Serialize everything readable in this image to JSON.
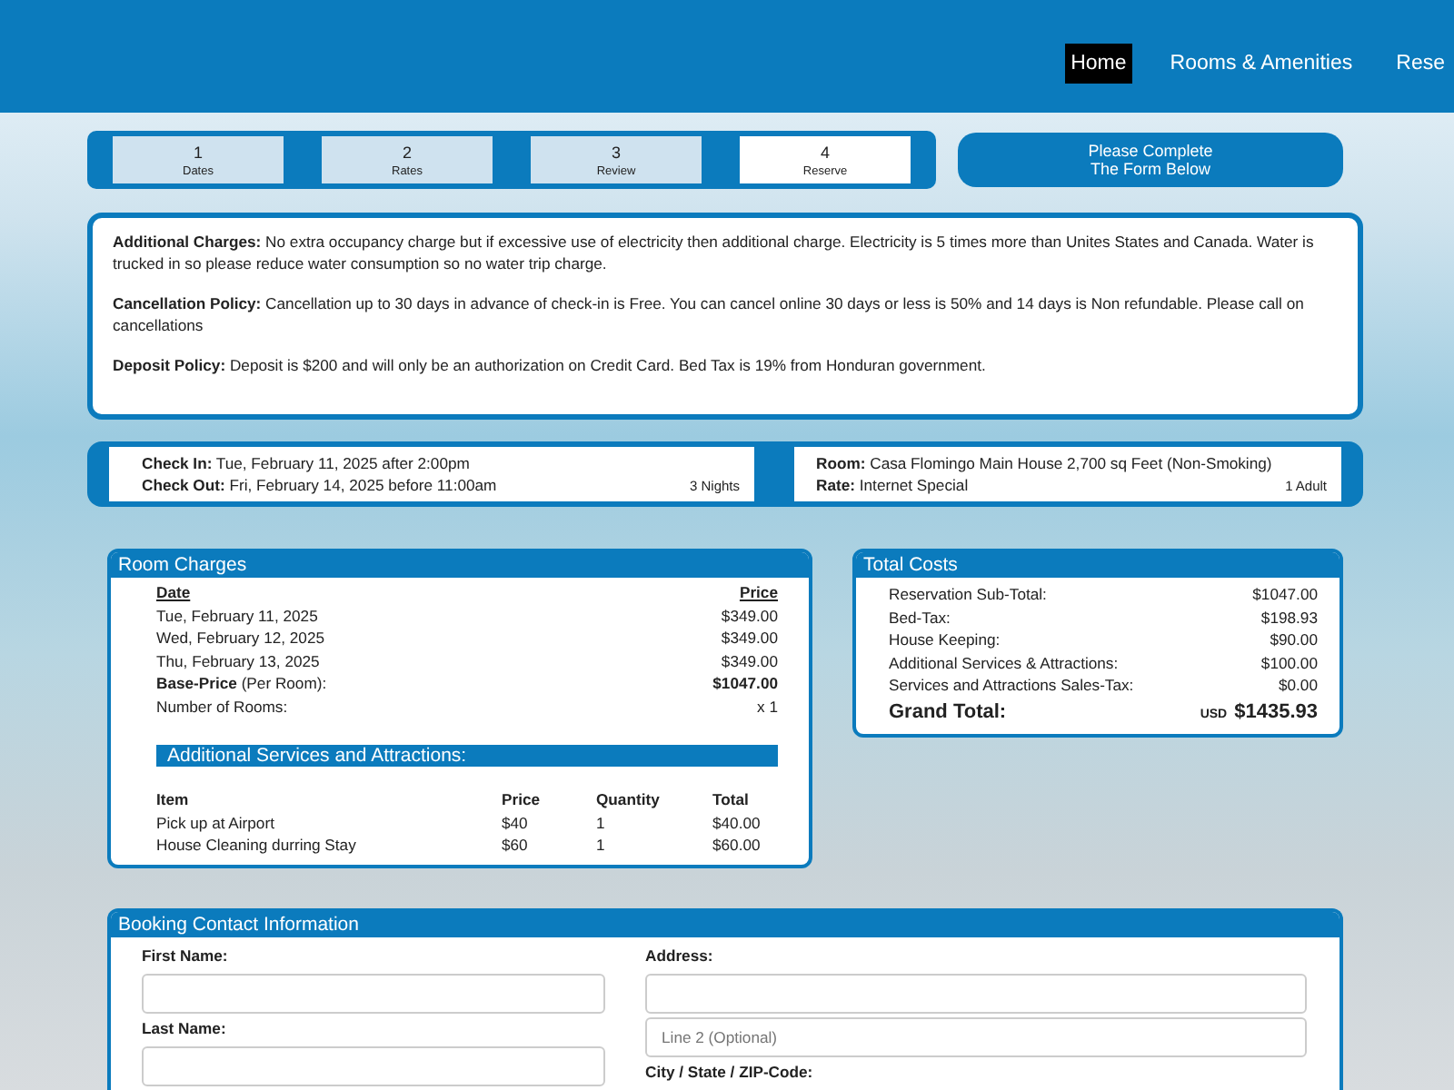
{
  "nav": {
    "links": [
      {
        "label": "Home",
        "selected": true
      },
      {
        "label": "Rooms & Amenities",
        "selected": false
      },
      {
        "label": "Rese",
        "selected": false
      }
    ]
  },
  "steps": [
    {
      "number": "1",
      "label": "Dates",
      "selected": false
    },
    {
      "number": "2",
      "label": "Rates",
      "selected": false
    },
    {
      "number": "3",
      "label": "Review",
      "selected": false
    },
    {
      "number": "4",
      "label": "Reserve",
      "selected": true
    }
  ],
  "notice": [
    "Please Complete",
    "The Form Below"
  ],
  "policies": [
    {
      "label": "Additional Charges:",
      "text": "No extra occupancy charge but if excessive use of electricity then additional charge. Electricity is 5 times more than Unites States and Canada. Water is trucked in so please reduce water consumption so no water trip charge."
    },
    {
      "label": "Cancellation Policy:",
      "text": "Cancellation up to 30 days in advance of check-in is Free. You can cancel online 30 days or less is 50% and 14 days is Non refundable. Please call on cancellations"
    },
    {
      "label": "Deposit Policy:",
      "text": "Deposit is $200 and will only be an authorization on Credit Card. Bed Tax is 19% from Honduran government."
    }
  ],
  "stay": {
    "check_in_label": "Check In:",
    "check_in": "Tue, February 11, 2025 after 2:00pm",
    "check_out_label": "Check Out:",
    "check_out": "Fri, February 14, 2025 before 11:00am",
    "nights": "3 Nights",
    "room_label": "Room:",
    "room": "Casa Flomingo Main House 2,700 sq Feet (Non-Smoking)",
    "rate_label": "Rate:",
    "rate": "Internet Special",
    "guests": "1 Adult"
  },
  "room_charges": {
    "title": "Room Charges",
    "date_header": "Date",
    "price_header": "Price",
    "nights": [
      {
        "date": "Tue, February 11, 2025",
        "price": "$349.00"
      },
      {
        "date": "Wed, February 12, 2025",
        "price": "$349.00"
      },
      {
        "date": "Thu, February 13, 2025",
        "price": "$349.00"
      }
    ],
    "base_price_label": "**Base-Price** (Per Room):",
    "base_price": "$1047.00",
    "rooms_label": "Number of Rooms:",
    "rooms": "x 1",
    "services_title": "Additional Services and Attractions:",
    "services_columns": [
      "Item",
      "Price",
      "Quantity",
      "Total"
    ],
    "services": [
      {
        "item": "Pick up at Airport",
        "price": "$40",
        "quantity": "1",
        "total": "$40.00"
      },
      {
        "item": "House Cleaning durring Stay",
        "price": "$60",
        "quantity": "1",
        "total": "$60.00"
      }
    ]
  },
  "total_costs": {
    "title": "Total Costs",
    "lines": [
      {
        "label": "Reservation Sub-Total:",
        "value": "$1047.00"
      },
      {
        "label": "Bed-Tax:",
        "value": "$198.93"
      },
      {
        "label": "House Keeping:",
        "value": "$90.00"
      },
      {
        "label": "Additional Services & Attractions:",
        "value": "$100.00"
      },
      {
        "label": "Services and Attractions Sales-Tax:",
        "value": "$0.00"
      }
    ],
    "grand_total_label": "Grand Total:",
    "currency": "USD",
    "grand_total": "$1435.93"
  },
  "contact": {
    "title": "Booking Contact Information",
    "first_name_label": "First Name:",
    "last_name_label": "Last Name:",
    "address_label": "Address:",
    "address_line2_placeholder": "Line 2 (Optional)",
    "city_label": "City / State / ZIP-Code:"
  }
}
